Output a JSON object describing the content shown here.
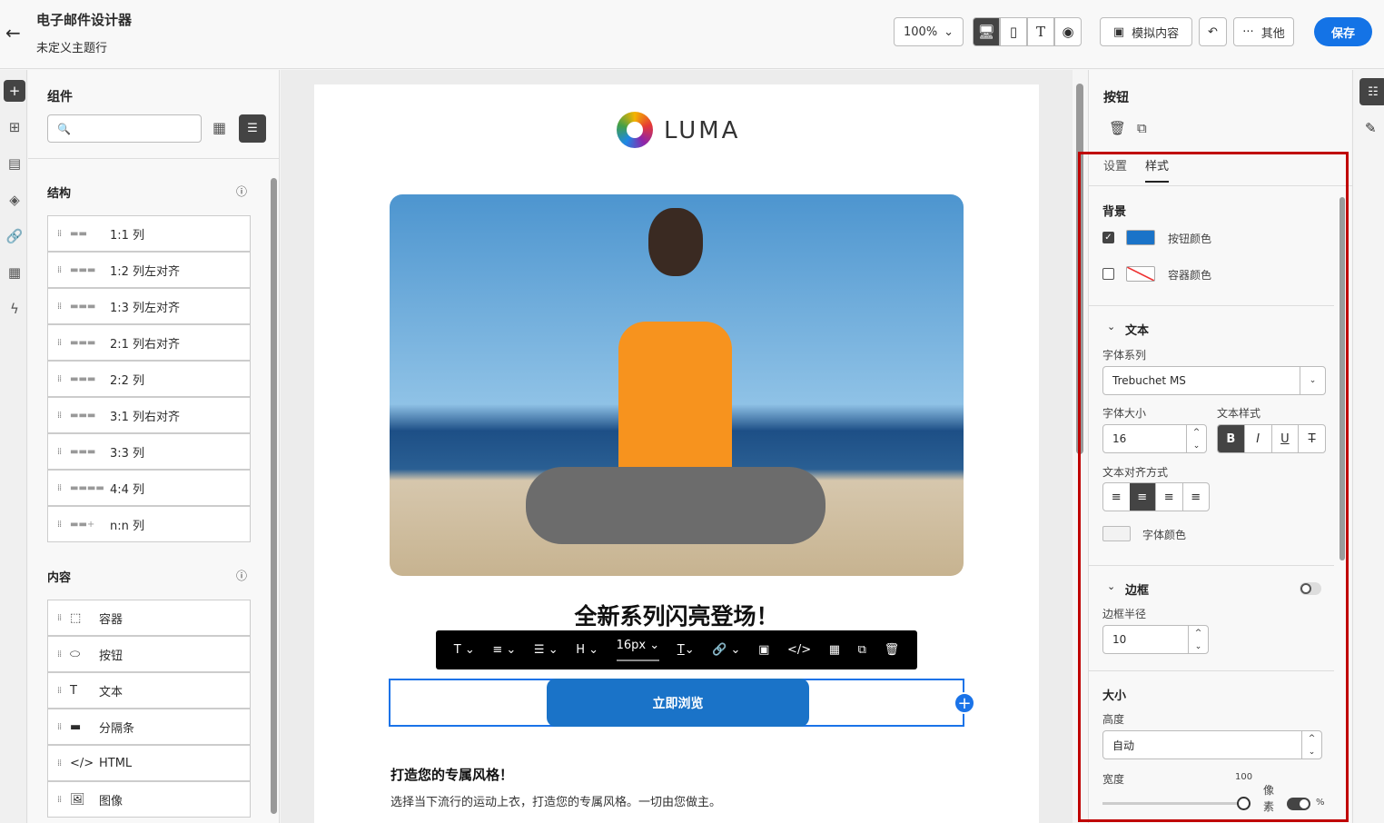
{
  "header": {
    "title": "电子邮件设计器",
    "subtitle": "未定义主题行",
    "zoom": "100%",
    "simulate_label": "模拟内容",
    "more_label": "其他",
    "save_label": "保存",
    "save_color": "#1473e6"
  },
  "left_panel": {
    "title": "组件",
    "search_placeholder": "",
    "structure": {
      "title": "结构",
      "items": [
        {
          "label": "1:1 列"
        },
        {
          "label": "1:2 列左对齐"
        },
        {
          "label": "1:3 列左对齐"
        },
        {
          "label": "2:1 列右对齐"
        },
        {
          "label": "2:2 列"
        },
        {
          "label": "3:1 列右对齐"
        },
        {
          "label": "3:3 列"
        },
        {
          "label": "4:4 列"
        },
        {
          "label": "n:n 列"
        }
      ]
    },
    "content": {
      "title": "内容",
      "items": [
        {
          "label": "容器",
          "icon": "container-icon"
        },
        {
          "label": "按钮",
          "icon": "button-icon"
        },
        {
          "label": "文本",
          "icon": "text-icon"
        },
        {
          "label": "分隔条",
          "icon": "divider-icon"
        },
        {
          "label": "HTML",
          "icon": "html-icon"
        },
        {
          "label": "图像",
          "icon": "image-icon"
        }
      ]
    }
  },
  "email": {
    "logo_text": "LUMA",
    "headline": "全新系列闪亮登场！",
    "button_label": "立即浏览",
    "button_color": "#1a73c8",
    "subheading": "打造您的专属风格！",
    "body": "选择当下流行的运动上衣，打造您的专属风格。一切由您做主。",
    "toolbar": {
      "font_size": "16px"
    }
  },
  "right_panel": {
    "title": "按钮",
    "tabs": [
      {
        "label": "设置"
      },
      {
        "label": "样式",
        "active": true
      }
    ],
    "background": {
      "title": "背景",
      "button_color_label": "按钮颜色",
      "button_color_checked": true,
      "button_color": "#1a73c8",
      "container_color_label": "容器颜色",
      "container_color_checked": false
    },
    "text": {
      "title": "文本",
      "font_family_label": "字体系列",
      "font_family": "Trebuchet MS",
      "font_size_label": "字体大小",
      "font_size": "16",
      "text_style_label": "文本样式",
      "align_label": "文本对齐方式",
      "font_color_label": "字体颜色"
    },
    "border": {
      "title": "边框",
      "enabled": false,
      "radius_label": "边框半径",
      "radius": "10"
    },
    "size": {
      "title": "大小",
      "height_label": "高度",
      "height": "自动",
      "width_label": "宽度",
      "width_value": "100",
      "unit_px": "像素",
      "unit_pct": "%",
      "percent_mode": true
    }
  },
  "highlight_color": "#c00000"
}
